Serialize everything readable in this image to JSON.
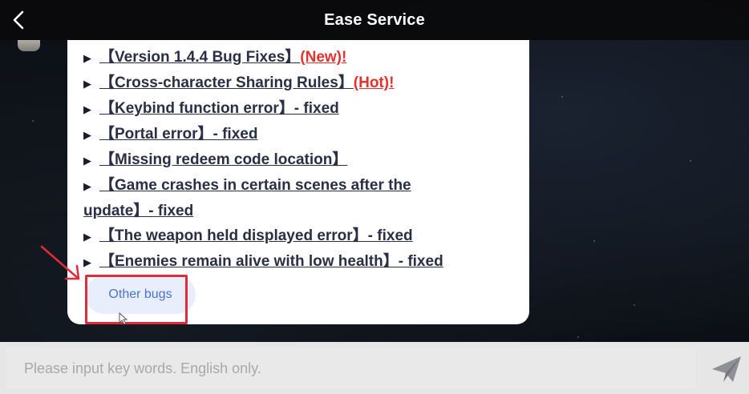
{
  "header": {
    "title": "Ease Service"
  },
  "items": [
    {
      "label": "【Version 1.4.4 Bug Fixes】",
      "tag": "(New)!"
    },
    {
      "label": "【Cross-character Sharing Rules】",
      "tag": "(Hot)!"
    },
    {
      "label": "【Keybind function error】- fixed"
    },
    {
      "label": "【Portal error】- fixed"
    },
    {
      "label": "【Missing redeem code location】"
    },
    {
      "label": "【Game crashes in certain scenes after the",
      "label_line2": "update】- fixed"
    },
    {
      "label": "【The weapon held displayed error】- fixed"
    },
    {
      "label": "【Enemies remain alive with low health】- fixed"
    }
  ],
  "other_button": {
    "label": "Other bugs"
  },
  "input": {
    "placeholder": "Please input key words. English only."
  },
  "colors": {
    "tag_red": "#e5322d",
    "annotation_red": "#e02b3a",
    "button_blue": "#4a72d9"
  },
  "icons": {
    "back": "chevron-left-icon",
    "send": "paper-plane-icon",
    "bullet": "triangle-right-icon"
  }
}
